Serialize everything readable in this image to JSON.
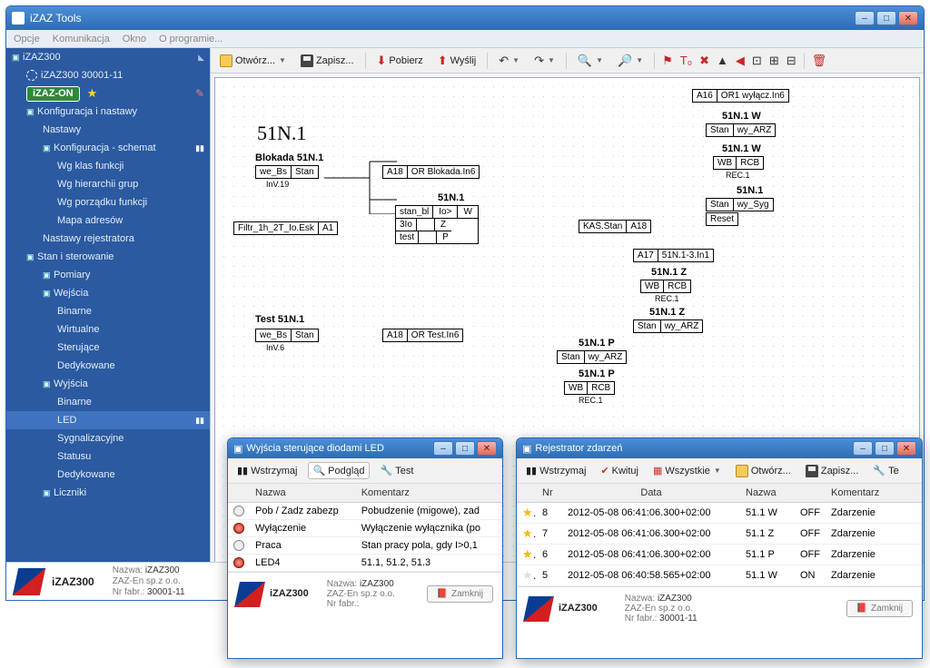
{
  "app": {
    "title": "iZAZ Tools"
  },
  "menu": {
    "opcje": "Opcje",
    "komunikacja": "Komunikacja",
    "okno": "Okno",
    "o_programie": "O programie..."
  },
  "sidebar": {
    "root": "iZAZ300",
    "device": "iZAZ300  30001-11",
    "badge": "iZAZ-ON",
    "groups": [
      {
        "label": "Konfiguracja i nastawy",
        "children": [
          {
            "label": "Nastawy"
          },
          {
            "label": "Konfiguracja - schemat",
            "children": [
              {
                "label": "Wg klas funkcji"
              },
              {
                "label": "Wg hierarchii grup"
              },
              {
                "label": "Wg porządku funkcji"
              },
              {
                "label": "Mapa adresów"
              }
            ]
          },
          {
            "label": "Nastawy rejestratora"
          }
        ]
      },
      {
        "label": "Stan i sterowanie",
        "children": [
          {
            "label": "Pomiary"
          },
          {
            "label": "Wejścia",
            "children": [
              {
                "label": "Binarne"
              },
              {
                "label": "Wirtualne"
              },
              {
                "label": "Sterujące"
              },
              {
                "label": "Dedykowane"
              }
            ]
          },
          {
            "label": "Wyjścia",
            "children": [
              {
                "label": "Binarne"
              },
              {
                "label": "LED"
              },
              {
                "label": "Sygnalizacyjne"
              },
              {
                "label": "Statusu"
              },
              {
                "label": "Dedykowane"
              }
            ]
          },
          {
            "label": "Liczniki"
          }
        ]
      }
    ]
  },
  "toolbar": {
    "otworz": "Otwórz...",
    "zapisz": "Zapisz...",
    "pobierz": "Pobierz",
    "wyslij": "Wyślij"
  },
  "chart_data": {
    "type": "diagram",
    "title": "51N.1",
    "blocks": [
      {
        "id": "blokada_title",
        "text": "Blokada 51N.1"
      },
      {
        "id": "blokada_node",
        "cells": [
          "we_Bs",
          "Stan"
        ],
        "sub": "InV.19"
      },
      {
        "id": "a18_blokada",
        "cells": [
          "A18",
          "OR Blokada.In6"
        ]
      },
      {
        "id": "filtr",
        "cells": [
          "Filtr_1h_2T_Io.Esk",
          "A1"
        ]
      },
      {
        "id": "fn_title",
        "text": "51N.1",
        "rows": [
          [
            "stan_bl",
            "Io>",
            "W"
          ],
          [
            "3Io",
            "",
            "Z"
          ],
          [
            "test",
            "",
            "P"
          ]
        ]
      },
      {
        "id": "test_title",
        "text": "Test 51N.1"
      },
      {
        "id": "test_node",
        "cells": [
          "we_Bs",
          "Stan"
        ],
        "sub": "InV.6"
      },
      {
        "id": "a18_test",
        "cells": [
          "A18",
          "OR Test.In6"
        ]
      },
      {
        "id": "a16",
        "cells": [
          "A16",
          "OR1 wyłącz.In6"
        ]
      },
      {
        "id": "w1",
        "title": "51N.1 W",
        "cells": [
          "Stan",
          "wy_ARZ"
        ]
      },
      {
        "id": "w2",
        "title": "51N.1 W",
        "cells": [
          "WB",
          "RCB"
        ],
        "sub": "REC.1"
      },
      {
        "id": "syg",
        "title": "51N.1",
        "cells": [
          "Stan",
          "wy_Syg"
        ],
        "extra": [
          "Reset"
        ]
      },
      {
        "id": "kas",
        "cells": [
          "KAS.Stan",
          "A18"
        ]
      },
      {
        "id": "a17",
        "cells": [
          "A17",
          "51N.1-3.In1"
        ]
      },
      {
        "id": "z1",
        "title": "51N.1 Z",
        "cells": [
          "WB",
          "RCB"
        ],
        "sub": "REC.1"
      },
      {
        "id": "z2",
        "title": "51N.1 Z",
        "cells": [
          "Stan",
          "wy_ARZ"
        ]
      },
      {
        "id": "p1",
        "title": "51N.1 P",
        "cells": [
          "Stan",
          "wy_ARZ"
        ]
      },
      {
        "id": "p2",
        "title": "51N.1 P",
        "cells": [
          "WB",
          "RCB"
        ],
        "sub": "REC.1"
      }
    ]
  },
  "led_window": {
    "title": "Wyjścia sterujące diodami LED",
    "toolbar": {
      "wstrzymaj": "Wstrzymaj",
      "podglad": "Podgląd",
      "test": "Test"
    },
    "cols": {
      "nazwa": "Nazwa",
      "komentarz": "Komentarz"
    },
    "rows": [
      {
        "on": false,
        "nazwa": "Pob / Zadz zabezp",
        "kom": "Pobudzenie (migowe), zad"
      },
      {
        "on": true,
        "nazwa": "Wyłączenie",
        "kom": "Wyłączenie wyłącznika (po"
      },
      {
        "on": false,
        "nazwa": "Praca",
        "kom": "Stan pracy pola, gdy I>0,1"
      },
      {
        "on": true,
        "nazwa": "LED4",
        "kom": "51.1, 51.2, 51.3"
      }
    ],
    "footer": {
      "nazwa_l": "Nazwa:",
      "nazwa": "iZAZ300",
      "vendor": "ZAZ-En sp.z o.o.",
      "nr_l": "Nr fabr.:",
      "close": "Zamknij"
    }
  },
  "rej_window": {
    "title": "Rejestrator zdarzeń",
    "toolbar": {
      "wstrzymaj": "Wstrzymaj",
      "kwituj": "Kwituj",
      "wszystkie": "Wszystkie",
      "otworz": "Otwórz...",
      "zapisz": "Zapisz...",
      "test": "Te"
    },
    "cols": {
      "nr": "Nr",
      "data": "Data",
      "nazwa": "Nazwa",
      "komentarz": "Komentarz"
    },
    "rows": [
      {
        "star": true,
        "nr": "8",
        "data": "2012-05-08 06:41:06.300+02:00",
        "nazwa": "51.1 W",
        "st": "OFF",
        "kom": "Zdarzenie"
      },
      {
        "star": true,
        "nr": "7",
        "data": "2012-05-08 06:41:06.300+02:00",
        "nazwa": "51.1 Z",
        "st": "OFF",
        "kom": "Zdarzenie"
      },
      {
        "star": true,
        "nr": "6",
        "data": "2012-05-08 06:41:06.300+02:00",
        "nazwa": "51.1 P",
        "st": "OFF",
        "kom": "Zdarzenie"
      },
      {
        "star": false,
        "nr": "5",
        "data": "2012-05-08 06:40:58.565+02:00",
        "nazwa": "51.1 W",
        "st": "ON",
        "kom": "Zdarzenie"
      }
    ],
    "footer": {
      "nazwa_l": "Nazwa:",
      "nazwa": "iZAZ300",
      "vendor": "ZAZ-En sp.z o.o.",
      "nr_l": "Nr fabr.:",
      "nr": "30001-11",
      "close": "Zamknij"
    }
  },
  "main_footer": {
    "nazwa_l": "Nazwa:",
    "nazwa": "iZAZ300",
    "vendor": "ZAZ-En sp.z o.o.",
    "nr_l": "Nr fabr.:",
    "nr": "30001-11",
    "bold": "iZAZ300"
  }
}
